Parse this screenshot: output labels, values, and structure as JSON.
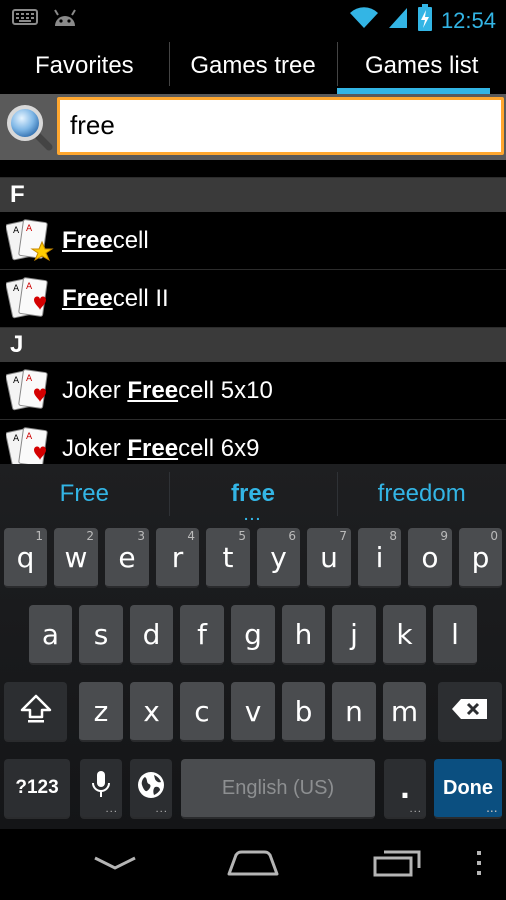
{
  "status_bar": {
    "time": "12:54",
    "icons": [
      "keyboard-icon",
      "android-icon",
      "wifi-icon",
      "signal-icon",
      "battery-charging-icon"
    ]
  },
  "tabs": [
    {
      "label": "Favorites",
      "active": false
    },
    {
      "label": "Games tree",
      "active": false
    },
    {
      "label": "Games list",
      "active": true
    }
  ],
  "search": {
    "value": "free",
    "placeholder": ""
  },
  "list": {
    "sections": [
      {
        "letter": "F",
        "items": [
          {
            "prefix": "",
            "match": "Free",
            "suffix": "cell",
            "icon": "cards-star-icon"
          },
          {
            "prefix": "",
            "match": "Free",
            "suffix": "cell II",
            "icon": "cards-heart-icon"
          }
        ]
      },
      {
        "letter": "J",
        "items": [
          {
            "prefix": "Joker ",
            "match": "Free",
            "suffix": "cell 5x10",
            "icon": "cards-heart-icon"
          },
          {
            "prefix": "Joker ",
            "match": "Free",
            "suffix": "cell 6x9",
            "icon": "cards-heart-icon"
          }
        ]
      }
    ]
  },
  "keyboard": {
    "suggestions": [
      "Free",
      "free",
      "freedom"
    ],
    "suggestion_dots": "...",
    "row1": [
      {
        "key": "q",
        "hint": "1"
      },
      {
        "key": "w",
        "hint": "2"
      },
      {
        "key": "e",
        "hint": "3"
      },
      {
        "key": "r",
        "hint": "4"
      },
      {
        "key": "t",
        "hint": "5"
      },
      {
        "key": "y",
        "hint": "6"
      },
      {
        "key": "u",
        "hint": "7"
      },
      {
        "key": "i",
        "hint": "8"
      },
      {
        "key": "o",
        "hint": "9"
      },
      {
        "key": "p",
        "hint": "0"
      }
    ],
    "row2": [
      "a",
      "s",
      "d",
      "f",
      "g",
      "h",
      "j",
      "k",
      "l"
    ],
    "row3": [
      "z",
      "x",
      "c",
      "v",
      "b",
      "n",
      "m"
    ],
    "symbols_label": "?123",
    "space_label": "English (US)",
    "period_label": ".",
    "done_label": "Done",
    "more_dots": "..."
  },
  "colors": {
    "accent": "#33b5e5",
    "search_border": "#ffa72f",
    "done_key": "#0b4f80"
  }
}
